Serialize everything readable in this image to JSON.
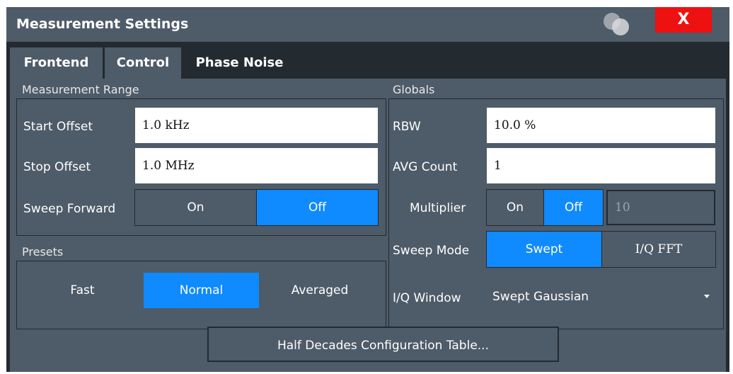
{
  "window": {
    "title": "Measurement Settings",
    "close_label": "X"
  },
  "tabs": [
    {
      "label": "Frontend",
      "active": false
    },
    {
      "label": "Control",
      "active": false
    },
    {
      "label": "Phase Noise",
      "active": true
    }
  ],
  "measurement_range": {
    "title": "Measurement Range",
    "start_offset": {
      "label": "Start Offset",
      "value": "1.0 kHz"
    },
    "stop_offset": {
      "label": "Stop Offset",
      "value": "1.0 MHz"
    },
    "sweep_forward": {
      "label": "Sweep Forward",
      "on": "On",
      "off": "Off",
      "selected": "Off"
    }
  },
  "presets": {
    "title": "Presets",
    "options": [
      "Fast",
      "Normal",
      "Averaged"
    ],
    "selected": "Normal"
  },
  "globals": {
    "title": "Globals",
    "rbw": {
      "label": "RBW",
      "value": "10.0 %"
    },
    "avg_count": {
      "label": "AVG Count",
      "value": "1"
    },
    "multiplier": {
      "label": "Multiplier",
      "on": "On",
      "off": "Off",
      "selected": "Off",
      "value": "10"
    },
    "sweep_mode": {
      "label": "Sweep Mode",
      "options": [
        "Swept",
        "I/Q FFT"
      ],
      "selected": "Swept"
    },
    "iq_window": {
      "label": "I/Q Window",
      "value": "Swept Gaussian"
    }
  },
  "half_decades_button": "Half Decades Configuration Table...",
  "colors": {
    "active_blue": "#0f8aff",
    "panel": "#4e5b68",
    "background": "#232a30",
    "close_red": "#ee1111"
  }
}
